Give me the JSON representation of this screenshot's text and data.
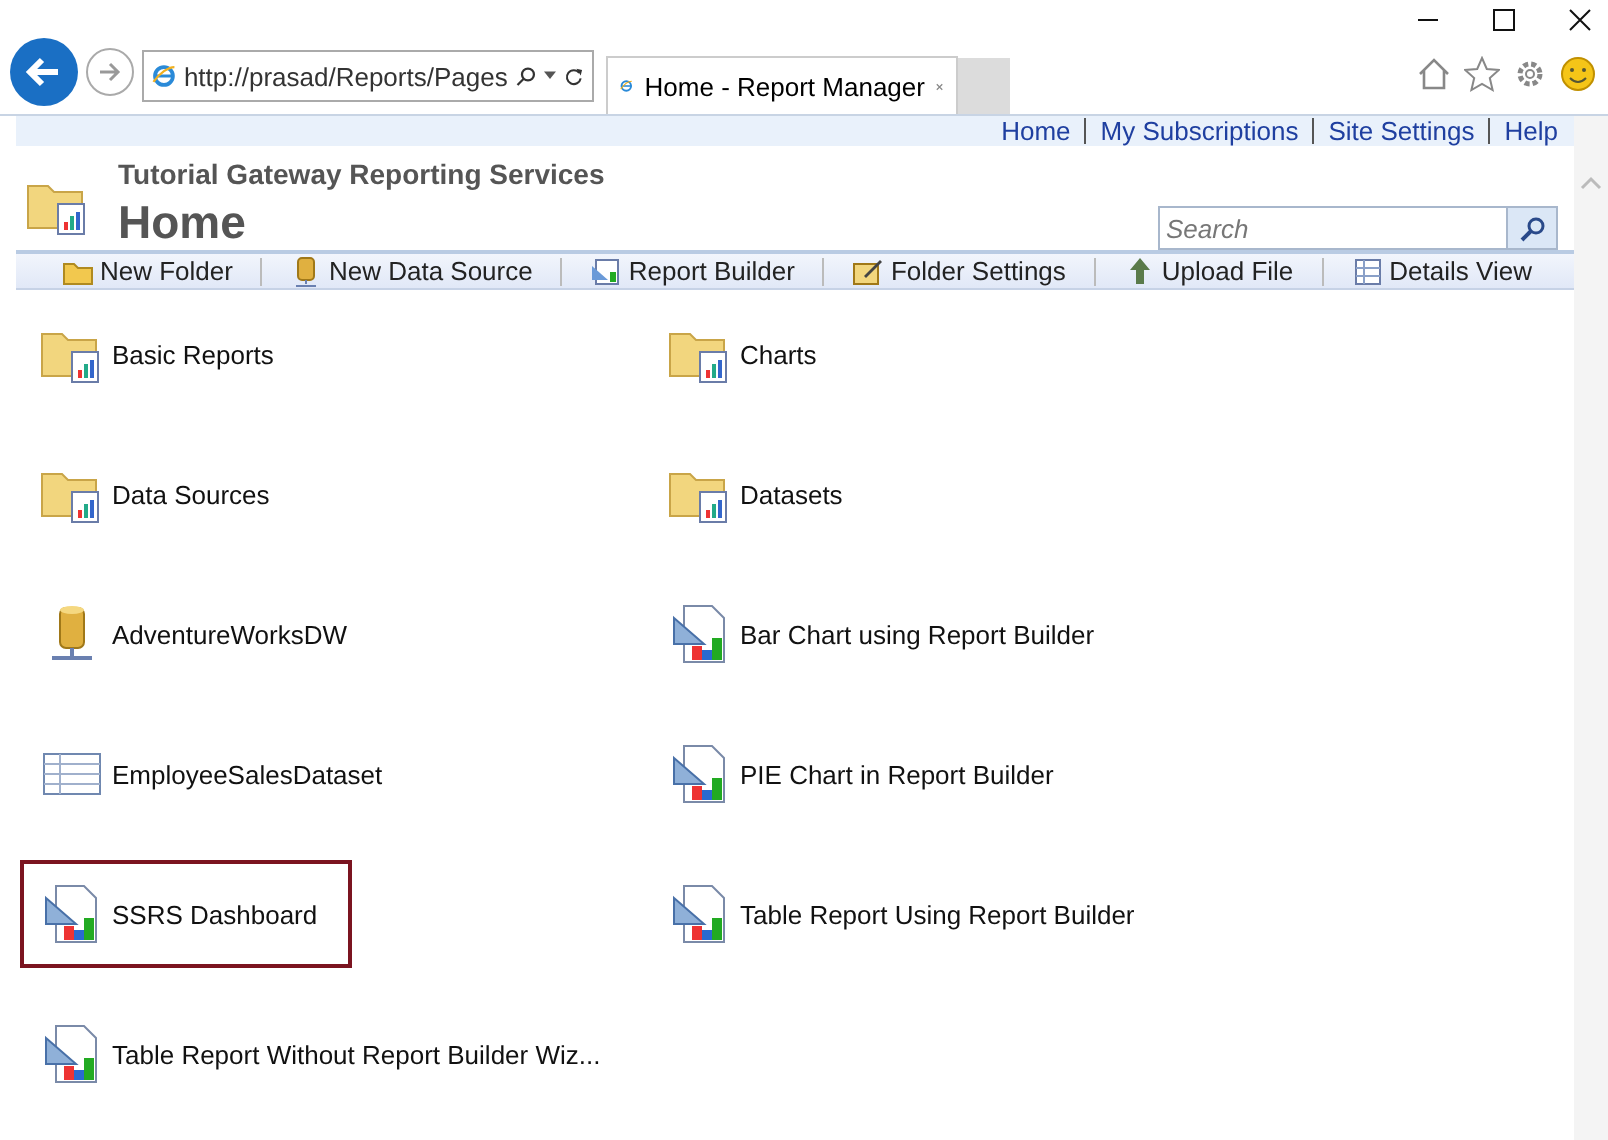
{
  "browser": {
    "address": "http://prasad/Reports/Pages",
    "tab_title": "Home - Report Manager"
  },
  "top_links": [
    "Home",
    "My Subscriptions",
    "Site Settings",
    "Help"
  ],
  "site_title": "Tutorial Gateway Reporting Services",
  "page_title": "Home",
  "search": {
    "placeholder": "Search"
  },
  "toolbar": [
    {
      "label": "New Folder",
      "kind": "folder"
    },
    {
      "label": "New Data Source",
      "kind": "datasource"
    },
    {
      "label": "Report Builder",
      "kind": "builder"
    },
    {
      "label": "Folder Settings",
      "kind": "settings"
    },
    {
      "label": "Upload File",
      "kind": "upload"
    },
    {
      "label": "Details View",
      "kind": "details"
    }
  ],
  "items": [
    {
      "name": "Basic Reports",
      "kind": "folder",
      "selected": false
    },
    {
      "name": "Charts",
      "kind": "folder",
      "selected": false
    },
    {
      "name": "Data Sources",
      "kind": "folder",
      "selected": false
    },
    {
      "name": "Datasets",
      "kind": "folder",
      "selected": false
    },
    {
      "name": "AdventureWorksDW",
      "kind": "datasource",
      "selected": false
    },
    {
      "name": "Bar Chart using Report Builder",
      "kind": "report",
      "selected": false
    },
    {
      "name": "EmployeeSalesDataset",
      "kind": "dataset",
      "selected": false
    },
    {
      "name": "PIE Chart in Report Builder",
      "kind": "report",
      "selected": false
    },
    {
      "name": "SSRS Dashboard",
      "kind": "report",
      "selected": true
    },
    {
      "name": "Table Report Using Report Builder",
      "kind": "report",
      "selected": false
    },
    {
      "name": "Table Report Without Report Builder Wiz...",
      "kind": "report",
      "selected": false
    }
  ]
}
